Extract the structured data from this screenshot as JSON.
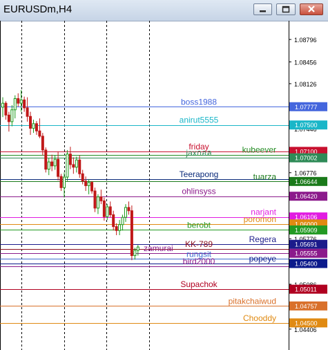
{
  "window": {
    "title": "EURUSDm,H4",
    "buttons": [
      "minimize",
      "maximize",
      "close"
    ]
  },
  "chart_data": {
    "type": "candlestick",
    "symbol": "EURUSDm",
    "timeframe": "H4",
    "price_axis_ticks": [
      "1.08796",
      "1.08456",
      "1.08126",
      "1.07446",
      "1.06776",
      "1.06446",
      "1.05776",
      "1.05436",
      "1.05086",
      "1.04406"
    ],
    "period_separators": 4,
    "candles": [
      {
        "o": 1.0777,
        "h": 1.0792,
        "l": 1.0762,
        "c": 1.0783
      },
      {
        "o": 1.0783,
        "h": 1.0786,
        "l": 1.0758,
        "c": 1.0765
      },
      {
        "o": 1.0765,
        "h": 1.077,
        "l": 1.074,
        "c": 1.0755
      },
      {
        "o": 1.0755,
        "h": 1.078,
        "l": 1.0748,
        "c": 1.0773
      },
      {
        "o": 1.0773,
        "h": 1.0795,
        "l": 1.076,
        "c": 1.079
      },
      {
        "o": 1.079,
        "h": 1.0798,
        "l": 1.0778,
        "c": 1.0783
      },
      {
        "o": 1.0783,
        "h": 1.0803,
        "l": 1.077,
        "c": 1.0788
      },
      {
        "o": 1.0788,
        "h": 1.0793,
        "l": 1.077,
        "c": 1.0776
      },
      {
        "o": 1.0776,
        "h": 1.0792,
        "l": 1.0755,
        "c": 1.0763
      },
      {
        "o": 1.0763,
        "h": 1.077,
        "l": 1.0735,
        "c": 1.0745
      },
      {
        "o": 1.0745,
        "h": 1.0758,
        "l": 1.0738,
        "c": 1.0752
      },
      {
        "o": 1.0752,
        "h": 1.0756,
        "l": 1.0735,
        "c": 1.0741
      },
      {
        "o": 1.0741,
        "h": 1.076,
        "l": 1.073,
        "c": 1.0733
      },
      {
        "o": 1.0733,
        "h": 1.0738,
        "l": 1.0704,
        "c": 1.0712
      },
      {
        "o": 1.0712,
        "h": 1.0716,
        "l": 1.0678,
        "c": 1.0683
      },
      {
        "o": 1.0683,
        "h": 1.07,
        "l": 1.0674,
        "c": 1.0694
      },
      {
        "o": 1.0694,
        "h": 1.0705,
        "l": 1.068,
        "c": 1.0688
      },
      {
        "o": 1.0688,
        "h": 1.0704,
        "l": 1.0682,
        "c": 1.0698
      },
      {
        "o": 1.0698,
        "h": 1.071,
        "l": 1.0666,
        "c": 1.0672
      },
      {
        "o": 1.0672,
        "h": 1.0676,
        "l": 1.065,
        "c": 1.0655
      },
      {
        "o": 1.0655,
        "h": 1.0678,
        "l": 1.064,
        "c": 1.0671
      },
      {
        "o": 1.0671,
        "h": 1.0712,
        "l": 1.0665,
        "c": 1.0706
      },
      {
        "o": 1.0706,
        "h": 1.0717,
        "l": 1.0683,
        "c": 1.069
      },
      {
        "o": 1.069,
        "h": 1.0701,
        "l": 1.0676,
        "c": 1.0686
      },
      {
        "o": 1.0686,
        "h": 1.0702,
        "l": 1.0678,
        "c": 1.0697
      },
      {
        "o": 1.0697,
        "h": 1.0704,
        "l": 1.067,
        "c": 1.0676
      },
      {
        "o": 1.0676,
        "h": 1.0682,
        "l": 1.066,
        "c": 1.0665
      },
      {
        "o": 1.0665,
        "h": 1.0672,
        "l": 1.065,
        "c": 1.0658
      },
      {
        "o": 1.0658,
        "h": 1.0668,
        "l": 1.0645,
        "c": 1.0663
      },
      {
        "o": 1.0663,
        "h": 1.0665,
        "l": 1.0646,
        "c": 1.065
      },
      {
        "o": 1.065,
        "h": 1.0655,
        "l": 1.0618,
        "c": 1.0624
      },
      {
        "o": 1.0624,
        "h": 1.0645,
        "l": 1.0615,
        "c": 1.0641
      },
      {
        "o": 1.0641,
        "h": 1.0652,
        "l": 1.063,
        "c": 1.0635
      },
      {
        "o": 1.0635,
        "h": 1.064,
        "l": 1.0605,
        "c": 1.0611
      },
      {
        "o": 1.0611,
        "h": 1.063,
        "l": 1.0606,
        "c": 1.0626
      },
      {
        "o": 1.0626,
        "h": 1.0634,
        "l": 1.061,
        "c": 1.0614
      },
      {
        "o": 1.0614,
        "h": 1.062,
        "l": 1.059,
        "c": 1.0596
      },
      {
        "o": 1.0596,
        "h": 1.0601,
        "l": 1.0583,
        "c": 1.059
      },
      {
        "o": 1.059,
        "h": 1.0606,
        "l": 1.0583,
        "c": 1.0599
      },
      {
        "o": 1.0599,
        "h": 1.0614,
        "l": 1.059,
        "c": 1.061
      },
      {
        "o": 1.061,
        "h": 1.063,
        "l": 1.0603,
        "c": 1.0625
      },
      {
        "o": 1.0625,
        "h": 1.0634,
        "l": 1.0614,
        "c": 1.062
      },
      {
        "o": 1.062,
        "h": 1.0628,
        "l": 1.0545,
        "c": 1.0552
      },
      {
        "o": 1.0552,
        "h": 1.0564,
        "l": 1.0546,
        "c": 1.056
      },
      {
        "o": 1.056,
        "h": 1.0568,
        "l": 1.0552,
        "c": 1.0565
      }
    ],
    "levels": [
      {
        "label": "boss1988",
        "price": 1.07777,
        "price_label": "1.07777",
        "color": "#4466dd",
        "label_side": "center"
      },
      {
        "label": "anirut5555",
        "price": 1.075,
        "price_label": "1.07500",
        "color": "#1ab6c8",
        "label_side": "center"
      },
      {
        "label": "friday",
        "price": 1.071,
        "price_label": "1.07100",
        "color": "#c8102e",
        "label_side": "center"
      },
      {
        "label": "kubeever",
        "price": 1.0705,
        "price_label": "",
        "color": "#228b22",
        "label_side": "right"
      },
      {
        "label": "jaxกอล",
        "price": 1.07002,
        "price_label": "1.07002",
        "color": "#2e8b57",
        "label_side": "center"
      },
      {
        "label": "Teerapong",
        "price": 1.0668,
        "price_label": "",
        "color": "#0a2a7a",
        "label_side": "center"
      },
      {
        "label": "tuarza",
        "price": 1.06644,
        "price_label": "1.06644",
        "color": "#1a7a1a",
        "label_side": "right"
      },
      {
        "label": "ohlinsyss",
        "price": 1.0642,
        "price_label": "1.06420",
        "color": "#8b1a8b",
        "label_side": "center"
      },
      {
        "label": "narjant",
        "price": 1.06106,
        "price_label": "1.06106",
        "color": "#e11ce1",
        "label_side": "right"
      },
      {
        "label": "poromon",
        "price": 1.06,
        "price_label": "1.06000",
        "color": "#e08a12",
        "label_side": "right"
      },
      {
        "label": "berobt",
        "price": 1.05909,
        "price_label": "1.05909",
        "color": "#239a23",
        "label_side": "center"
      },
      {
        "label": "Regera",
        "price": 1.05691,
        "price_label": "1.05691",
        "color": "#1b1b8b",
        "label_side": "right"
      },
      {
        "label": "KK-789",
        "price": 1.0562,
        "price_label": "",
        "color": "#8b1020",
        "label_side": "center"
      },
      {
        "label": "zamurai",
        "price": 1.05555,
        "price_label": "1.05555",
        "color": "#8b1a8b",
        "label_side": "left"
      },
      {
        "label": "rungsit",
        "price": 1.0547,
        "price_label": "",
        "color": "#3b6ed1",
        "label_side": "center"
      },
      {
        "label": "popeye",
        "price": 1.054,
        "price_label": "1.05400",
        "color": "#0b1a8b",
        "label_side": "right"
      },
      {
        "label": "bird2000",
        "price": 1.0536,
        "price_label": "",
        "color": "#8b1a8b",
        "label_side": "center"
      },
      {
        "label": "Supachok",
        "price": 1.05011,
        "price_label": "1.05011",
        "color": "#b00020",
        "label_side": "center"
      },
      {
        "label": "pitakchaiwud",
        "price": 1.04757,
        "price_label": "1.04757",
        "color": "#d9702a",
        "label_side": "right"
      },
      {
        "label": "Chooddy",
        "price": 1.045,
        "price_label": "1.04500",
        "color": "#e08a12",
        "label_side": "right"
      }
    ],
    "grid": false
  }
}
